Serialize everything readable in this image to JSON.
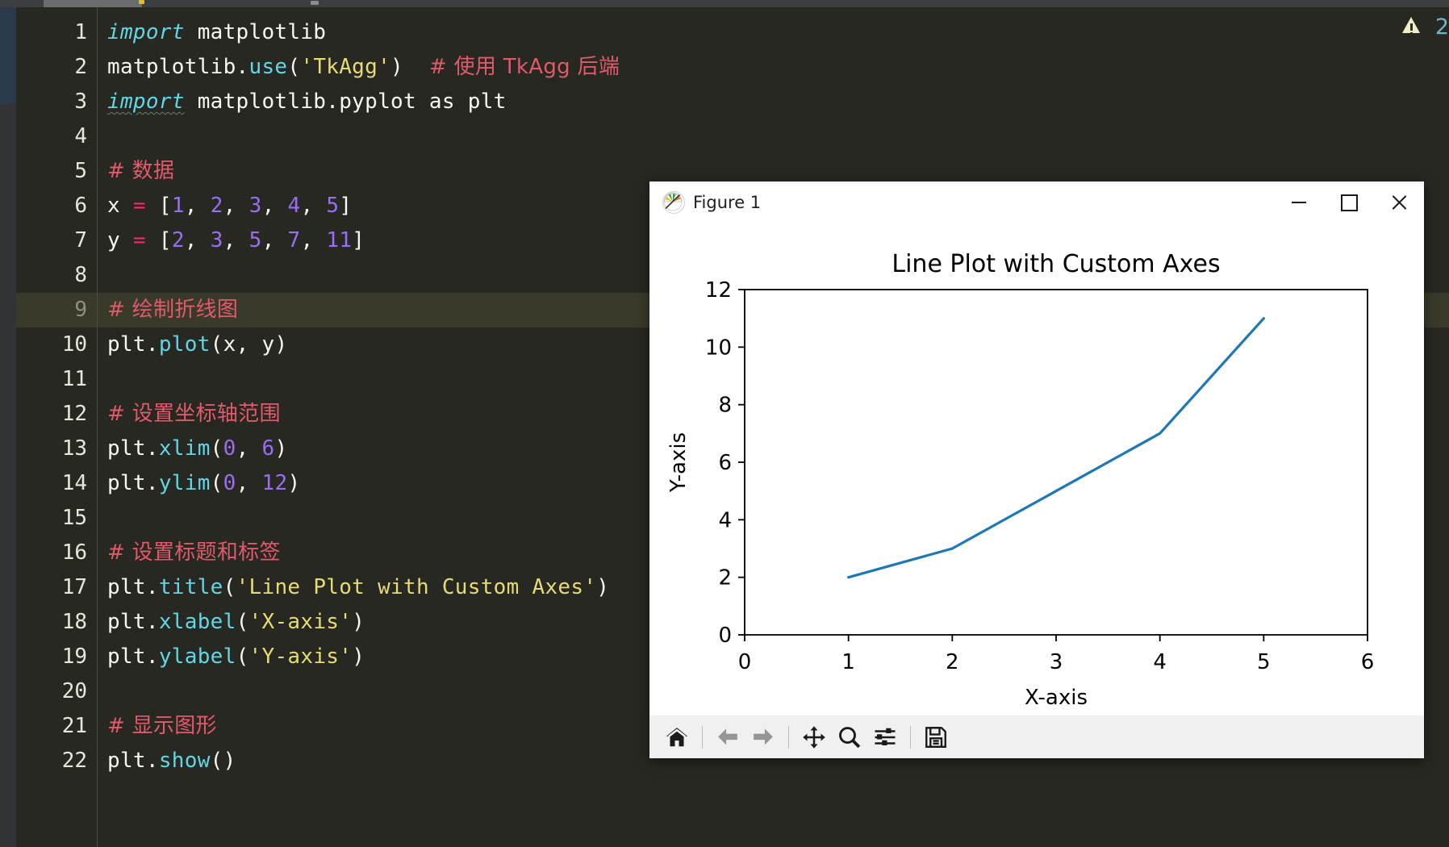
{
  "editor": {
    "background_color": "#272822",
    "current_line": 9,
    "warning_icon": "warning-triangle-icon",
    "warning_count": "2",
    "lines": [
      {
        "n": "1",
        "plain": "import matplotlib"
      },
      {
        "n": "2",
        "plain": "matplotlib.use('TkAgg')  # 使用 TkAgg 后端"
      },
      {
        "n": "3",
        "plain": "import matplotlib.pyplot as plt"
      },
      {
        "n": "4",
        "plain": ""
      },
      {
        "n": "5",
        "plain": "# 数据"
      },
      {
        "n": "6",
        "plain": "x = [1, 2, 3, 4, 5]"
      },
      {
        "n": "7",
        "plain": "y = [2, 3, 5, 7, 11]"
      },
      {
        "n": "8",
        "plain": ""
      },
      {
        "n": "9",
        "plain": "# 绘制折线图"
      },
      {
        "n": "10",
        "plain": "plt.plot(x, y)"
      },
      {
        "n": "11",
        "plain": ""
      },
      {
        "n": "12",
        "plain": "# 设置坐标轴范围"
      },
      {
        "n": "13",
        "plain": "plt.xlim(0, 6)"
      },
      {
        "n": "14",
        "plain": "plt.ylim(0, 12)"
      },
      {
        "n": "15",
        "plain": ""
      },
      {
        "n": "16",
        "plain": "# 设置标题和标签"
      },
      {
        "n": "17",
        "plain": "plt.title('Line Plot with Custom Axes')"
      },
      {
        "n": "18",
        "plain": "plt.xlabel('X-axis')"
      },
      {
        "n": "19",
        "plain": "plt.ylabel('Y-axis')"
      },
      {
        "n": "20",
        "plain": ""
      },
      {
        "n": "21",
        "plain": "# 显示图形"
      },
      {
        "n": "22",
        "plain": "plt.show()"
      }
    ],
    "syntax_colors": {
      "keyword": "#63d6e6",
      "string": "#e6db74",
      "number": "#9a6ef0",
      "operator": "#f92672",
      "comment": "#e05a6b",
      "plain": "#f8f8f2"
    }
  },
  "figure_window": {
    "title": "Figure 1",
    "icon": "matplotlib-logo-icon",
    "window_buttons": {
      "minimize": "minimize-icon",
      "maximize": "maximize-icon",
      "close": "close-icon"
    },
    "toolbar": [
      {
        "name": "home-button",
        "tip": "Home",
        "enabled": true
      },
      {
        "name": "back-button",
        "tip": "Back",
        "enabled": false
      },
      {
        "name": "forward-button",
        "tip": "Forward",
        "enabled": false
      },
      {
        "name": "pan-button",
        "tip": "Pan",
        "enabled": true
      },
      {
        "name": "zoom-button",
        "tip": "Zoom to rectangle",
        "enabled": true
      },
      {
        "name": "configure-subplots-button",
        "tip": "Configure subplots",
        "enabled": true
      },
      {
        "name": "save-button",
        "tip": "Save the figure",
        "enabled": true
      }
    ]
  },
  "chart_data": {
    "type": "line",
    "title": "Line Plot with Custom Axes",
    "xlabel": "X-axis",
    "ylabel": "Y-axis",
    "x": [
      1,
      2,
      3,
      4,
      5
    ],
    "y": [
      2,
      3,
      5,
      7,
      11
    ],
    "xlim": [
      0,
      6
    ],
    "ylim": [
      0,
      12
    ],
    "xticks": [
      0,
      1,
      2,
      3,
      4,
      5,
      6
    ],
    "yticks": [
      0,
      2,
      4,
      6,
      8,
      10,
      12
    ],
    "grid": false,
    "legend": null,
    "line_color": "#1f77b4",
    "line_width": 1.5,
    "series": [
      {
        "name": "y",
        "values": [
          2,
          3,
          5,
          7,
          11
        ]
      }
    ]
  }
}
